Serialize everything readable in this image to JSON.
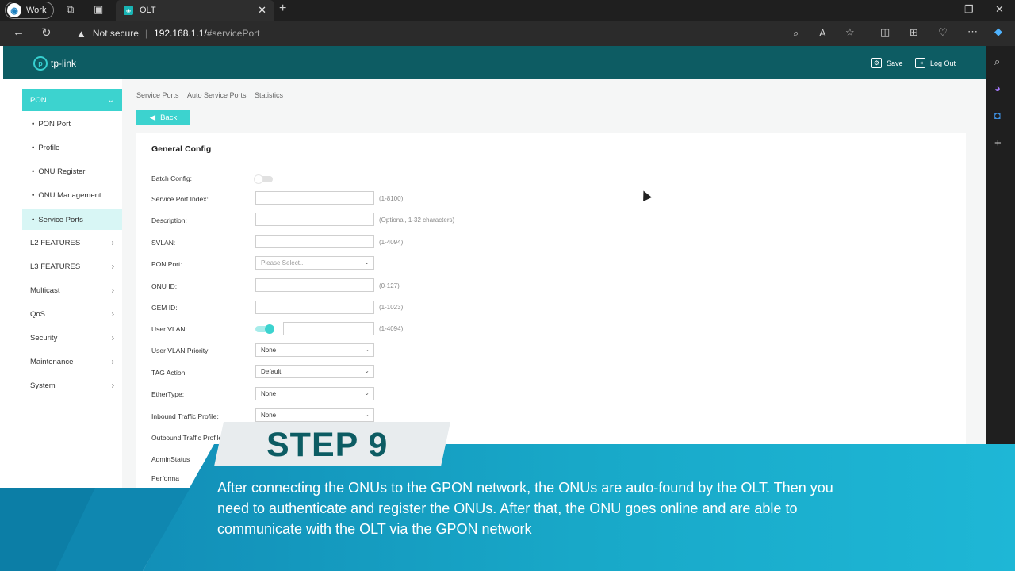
{
  "browser": {
    "profile_label": "Work",
    "tab_title": "OLT",
    "security_label": "Not secure",
    "url_host": "192.168.1.1/",
    "url_hash": "#servicePort"
  },
  "header": {
    "logo_text": "tp-link",
    "save_label": "Save",
    "logout_label": "Log Out"
  },
  "sidebar": {
    "pon_label": "PON",
    "sub_items": [
      "PON Port",
      "Profile",
      "ONU Register",
      "ONU Management",
      "Service Ports"
    ],
    "items": [
      "L2 FEATURES",
      "L3 FEATURES",
      "Multicast",
      "QoS",
      "Security",
      "Maintenance",
      "System"
    ]
  },
  "breadcrumb": {
    "tabs": [
      "Service Ports",
      "Auto Service Ports",
      "Statistics"
    ]
  },
  "back_label": "Back",
  "panel": {
    "title": "General Config",
    "fields": {
      "batch_config": "Batch Config:",
      "service_port_index": "Service Port Index:",
      "service_port_index_hint": "(1-8100)",
      "description": "Description:",
      "description_hint": "(Optional, 1-32 characters)",
      "svlan": "SVLAN:",
      "svlan_hint": "(1-4094)",
      "pon_port": "PON Port:",
      "pon_port_placeholder": "Please Select...",
      "onu_id": "ONU ID:",
      "onu_id_hint": "(0-127)",
      "gem_id": "GEM ID:",
      "gem_id_hint": "(1-1023)",
      "user_vlan": "User VLAN:",
      "user_vlan_hint": "(1-4094)",
      "user_vlan_priority": "User VLAN Priority:",
      "user_vlan_priority_value": "None",
      "tag_action": "TAG Action:",
      "tag_action_value": "Default",
      "ethertype": "EtherType:",
      "ethertype_value": "None",
      "inbound_profile": "Inbound Traffic Profile:",
      "inbound_profile_value": "None",
      "outbound_profile": "Outbound Traffic Profile",
      "admin_status": "AdminStatus",
      "performance": "Performa"
    }
  },
  "overlay": {
    "step": "STEP 9",
    "caption": "After connecting the ONUs to the GPON network, the ONUs are auto-found by the OLT. Then you need to authenticate and register the ONUs. After that, the ONU goes online and are able to communicate with the OLT via the GPON network"
  },
  "colors": {
    "header_bg": "#0d5c63",
    "accent": "#3cd3cf",
    "banner": "#1aa3c4"
  }
}
